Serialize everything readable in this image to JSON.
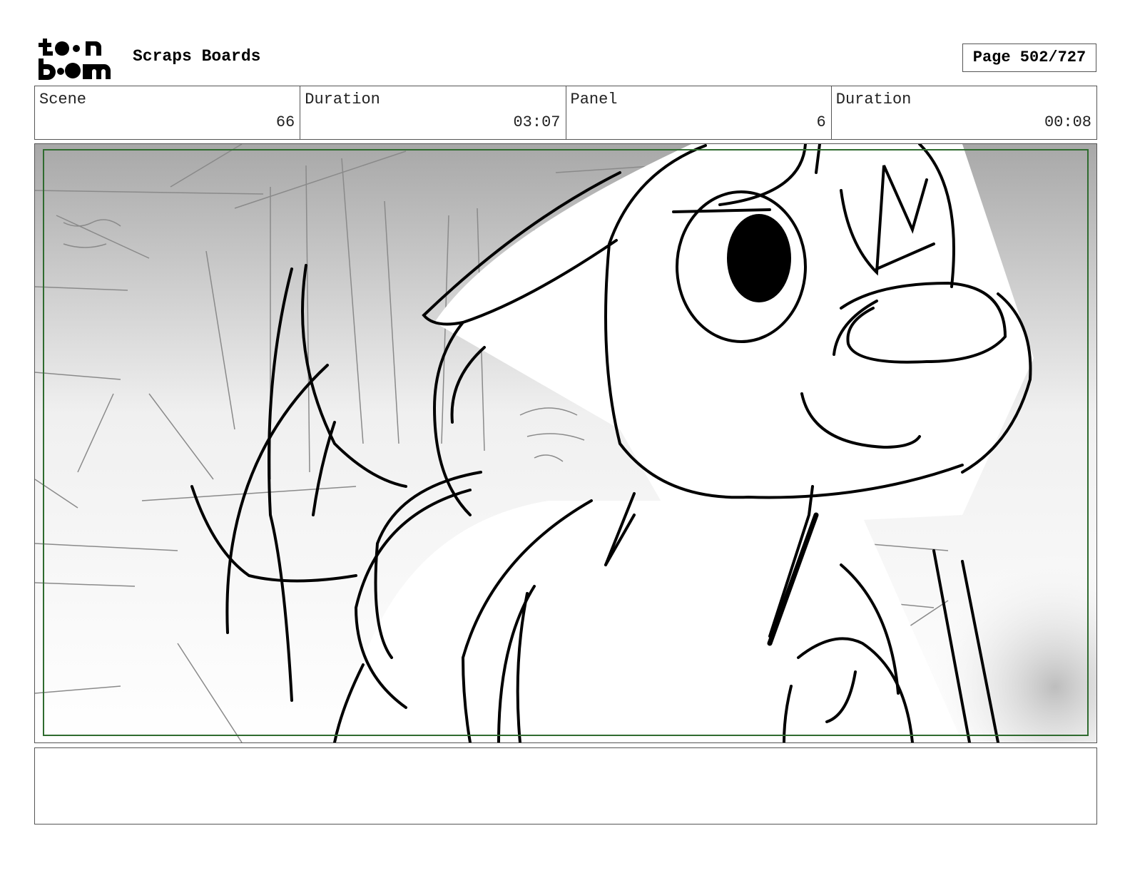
{
  "logo": {
    "line1": "toon",
    "line2": "boom"
  },
  "header": {
    "project_title": "Scraps Boards",
    "page_label": "Page 502/727"
  },
  "info": {
    "scene_label": "Scene",
    "scene_value": "66",
    "scene_duration_label": "Duration",
    "scene_duration_value": "03:07",
    "panel_label": "Panel",
    "panel_value": "6",
    "panel_duration_label": "Duration",
    "panel_duration_value": "00:08"
  },
  "notes": {
    "text": ""
  }
}
